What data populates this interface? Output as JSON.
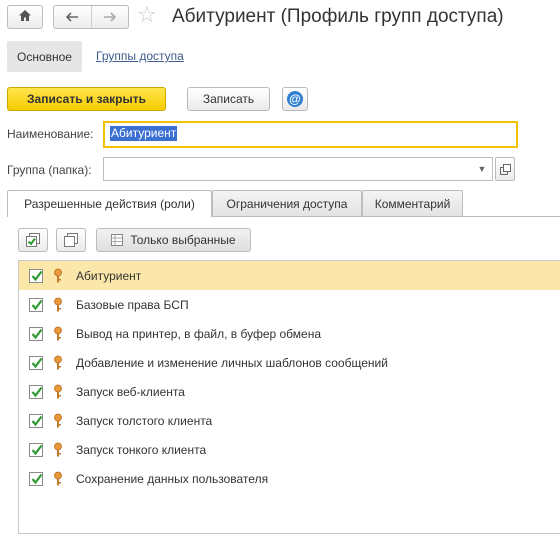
{
  "window": {
    "title": "Абитуриент (Профиль групп доступа)"
  },
  "icons": {
    "home": "home-icon",
    "back": "arrow-left-icon",
    "forward": "arrow-right-icon",
    "favorite": "star-icon",
    "email": "at-sign-icon",
    "check_all": "check-all-icon",
    "uncheck_all": "uncheck-all-icon",
    "filter": "filter-table-icon",
    "dropdown": "triangle-down-icon",
    "open": "open-window-icon",
    "role": "key-icon"
  },
  "section_tabs": {
    "main": "Основное",
    "groups": "Группы доступа"
  },
  "commands": {
    "save_close": "Записать и закрыть",
    "save": "Записать"
  },
  "fields": {
    "name_label": "Наименование:",
    "name_value": "Абитуриент",
    "group_label": "Группа (папка):",
    "group_value": ""
  },
  "tabs": {
    "roles": "Разрешенные действия (роли)",
    "restrictions": "Ограничения доступа",
    "comment": "Комментарий"
  },
  "list_toolbar": {
    "only_selected": "Только выбранные"
  },
  "roles": [
    {
      "label": "Абитуриент",
      "checked": true,
      "selected": true
    },
    {
      "label": "Базовые права БСП",
      "checked": true
    },
    {
      "label": "Вывод на принтер, в файл, в буфер обмена",
      "checked": true
    },
    {
      "label": "Добавление и изменение личных шаблонов сообщений",
      "checked": true
    },
    {
      "label": "Запуск веб-клиента",
      "checked": true
    },
    {
      "label": "Запуск толстого клиента",
      "checked": true
    },
    {
      "label": "Запуск тонкого клиента",
      "checked": true
    },
    {
      "label": "Сохранение данных пользователя",
      "checked": true
    }
  ],
  "colors": {
    "primary_button": "#f5cc00",
    "selected_row": "#fbe7a9",
    "checkmark": "#2e9a32",
    "link": "#3c5a8a",
    "focus_border": "#f2c200"
  }
}
